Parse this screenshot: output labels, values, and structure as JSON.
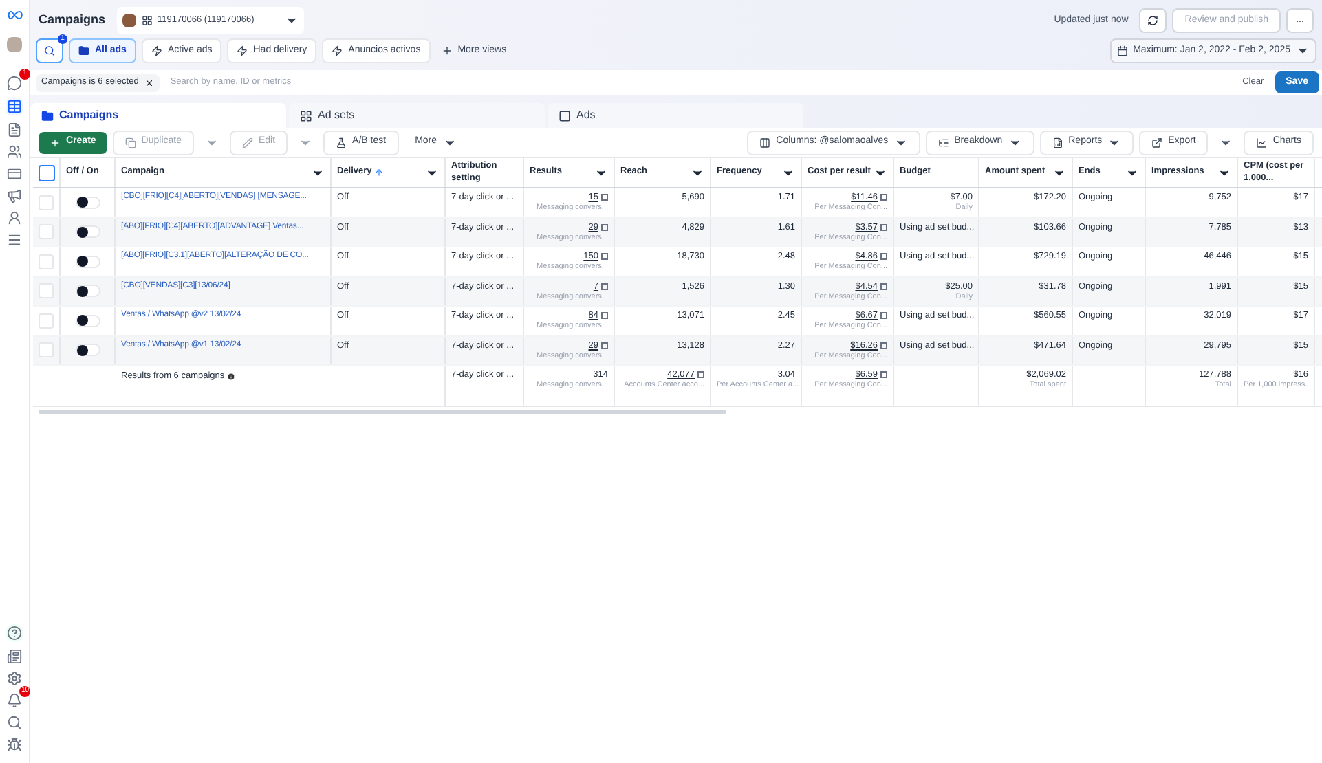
{
  "header": {
    "title": "Campaigns",
    "account": "119170066 (119170066)",
    "updated": "Updated just now",
    "publish": "Review and publish",
    "more": "...",
    "date_range": "Maximum: Jan 2, 2022 - Feb 2, 2025"
  },
  "search_badge": "1",
  "views": [
    {
      "label": "All ads",
      "selected": true
    },
    {
      "label": "Active ads",
      "selected": false
    },
    {
      "label": "Had delivery",
      "selected": false
    },
    {
      "label": "Anuncios activos",
      "selected": false
    }
  ],
  "more_views": "More views",
  "filter": {
    "chip": "Campaigns is 6 selected",
    "placeholder": "Search by name, ID or metrics",
    "clear": "Clear",
    "save": "Save"
  },
  "tabs": [
    {
      "label": "Campaigns",
      "selected": true
    },
    {
      "label": "Ad sets",
      "selected": false
    },
    {
      "label": "Ads",
      "selected": false
    }
  ],
  "toolbar": {
    "create": "Create",
    "duplicate": "Duplicate",
    "edit": "Edit",
    "ab_test": "A/B test",
    "more": "More",
    "columns": "Columns: @salomaoalves",
    "breakdown": "Breakdown",
    "reports": "Reports",
    "export": "Export",
    "charts": "Charts"
  },
  "select_all": {
    "checked": false
  },
  "columns": [
    {
      "label": "Off / On",
      "menu": false,
      "sorted": false
    },
    {
      "label": "Campaign",
      "menu": true,
      "sorted": false
    },
    {
      "label": "Delivery",
      "menu": true,
      "sorted": true
    },
    {
      "label": "Attribution setting",
      "menu": false,
      "sorted": false
    },
    {
      "label": "Results",
      "menu": true,
      "sorted": false
    },
    {
      "label": "Reach",
      "menu": true,
      "sorted": false
    },
    {
      "label": "Frequency",
      "menu": true,
      "sorted": false
    },
    {
      "label": "Cost per result",
      "menu": true,
      "sorted": false
    },
    {
      "label": "Budget",
      "menu": false,
      "sorted": false
    },
    {
      "label": "Amount spent",
      "menu": true,
      "sorted": false
    },
    {
      "label": "Ends",
      "menu": true,
      "sorted": false
    },
    {
      "label": "Impressions",
      "menu": true,
      "sorted": false
    },
    {
      "label": "CPM (cost per 1,000...",
      "menu": false,
      "sorted": false
    }
  ],
  "rows": [
    {
      "checked": false,
      "on": false,
      "campaign": "[CBO][FRIO][C4][ABERTO][VENDAS] [MENSAGE...",
      "delivery": "Off",
      "attribution": "7-day click or ...",
      "results": "15",
      "results_sub": "Messaging convers...",
      "reach": "5,690",
      "frequency": "1.71",
      "cost": "$11.46",
      "cost_sub": "Per Messaging Con...",
      "budget": "$7.00",
      "budget_sub": "Daily",
      "amount": "$172.20",
      "ends": "Ongoing",
      "impressions": "9,752",
      "cpm": "$17"
    },
    {
      "checked": false,
      "on": false,
      "campaign": "[ABO][FRIO][C4][ABERTO][ADVANTAGE] Ventas...",
      "delivery": "Off",
      "attribution": "7-day click or ...",
      "results": "29",
      "results_sub": "Messaging convers...",
      "reach": "4,829",
      "frequency": "1.61",
      "cost": "$3.57",
      "cost_sub": "Per Messaging Con...",
      "budget": "Using ad set bud...",
      "amount": "$103.66",
      "ends": "Ongoing",
      "impressions": "7,785",
      "cpm": "$13"
    },
    {
      "checked": false,
      "on": false,
      "campaign": "[ABO][FRIO][C3.1][ABERTO][ALTERAÇÃO DE CO...",
      "delivery": "Off",
      "attribution": "7-day click or ...",
      "results": "150",
      "results_sub": "Messaging convers...",
      "reach": "18,730",
      "frequency": "2.48",
      "cost": "$4.86",
      "cost_sub": "Per Messaging Con...",
      "budget": "Using ad set bud...",
      "amount": "$729.19",
      "ends": "Ongoing",
      "impressions": "46,446",
      "cpm": "$15"
    },
    {
      "checked": false,
      "on": false,
      "campaign": "[CBO][VENDAS][C3][13/06/24]",
      "delivery": "Off",
      "attribution": "7-day click or ...",
      "results": "7",
      "results_sub": "Messaging convers...",
      "reach": "1,526",
      "frequency": "1.30",
      "cost": "$4.54",
      "cost_sub": "Per Messaging Con...",
      "budget": "$25.00",
      "budget_sub": "Daily",
      "amount": "$31.78",
      "ends": "Ongoing",
      "impressions": "1,991",
      "cpm": "$15"
    },
    {
      "checked": false,
      "on": false,
      "campaign": "Ventas / WhatsApp @v2 13/02/24",
      "delivery": "Off",
      "attribution": "7-day click or ...",
      "results": "84",
      "results_sub": "Messaging convers...",
      "reach": "13,071",
      "frequency": "2.45",
      "cost": "$6.67",
      "cost_sub": "Per Messaging Con...",
      "budget": "Using ad set bud...",
      "amount": "$560.55",
      "ends": "Ongoing",
      "impressions": "32,019",
      "cpm": "$17"
    },
    {
      "checked": false,
      "on": false,
      "campaign": "Ventas / WhatsApp @v1 13/02/24",
      "delivery": "Off",
      "attribution": "7-day click or ...",
      "results": "29",
      "results_sub": "Messaging convers...",
      "reach": "13,128",
      "frequency": "2.27",
      "cost": "$16.26",
      "cost_sub": "Per Messaging Con...",
      "budget": "Using ad set bud...",
      "amount": "$471.64",
      "ends": "Ongoing",
      "impressions": "29,795",
      "cpm": "$15"
    }
  ],
  "summary": {
    "label": "Results from 6 campaigns",
    "attribution": "7-day click or ...",
    "results": "314",
    "results_sub": "Messaging convers...",
    "reach": "42,077",
    "reach_sub": "Accounts Center acco...",
    "frequency": "3.04",
    "frequency_sub": "Per Accounts Center a...",
    "cost": "$6.59",
    "cost_sub": "Per Messaging Con...",
    "amount": "$2,069.02",
    "amount_sub": "Total spent",
    "impressions": "127,788",
    "impressions_sub": "Total",
    "cpm": "$16",
    "cpm_sub": "Per 1,000 impress..."
  },
  "sidebar": {
    "notification_badge": "1",
    "bell_badge": "10"
  }
}
